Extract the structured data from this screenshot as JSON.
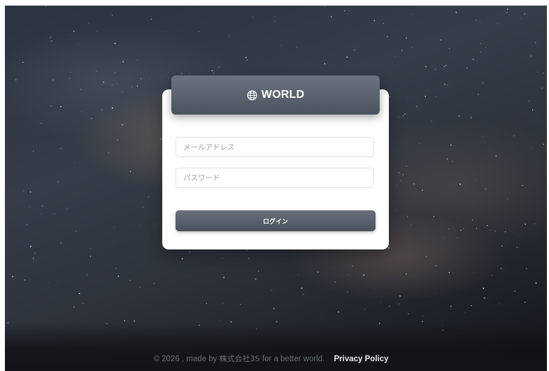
{
  "brand": {
    "title": "WORLD",
    "icon": "globe-icon"
  },
  "form": {
    "email_placeholder": "メールアドレス",
    "password_placeholder": "パスワード",
    "login_label": "ログイン"
  },
  "footer": {
    "copyright_prefix": "© 2026 , made by",
    "company": "株式会社3S",
    "copyright_suffix": "for a better world.",
    "privacy_label": "Privacy Policy"
  },
  "colors": {
    "header": "#5a606c",
    "button": "#5a606c",
    "card": "#ffffff"
  }
}
